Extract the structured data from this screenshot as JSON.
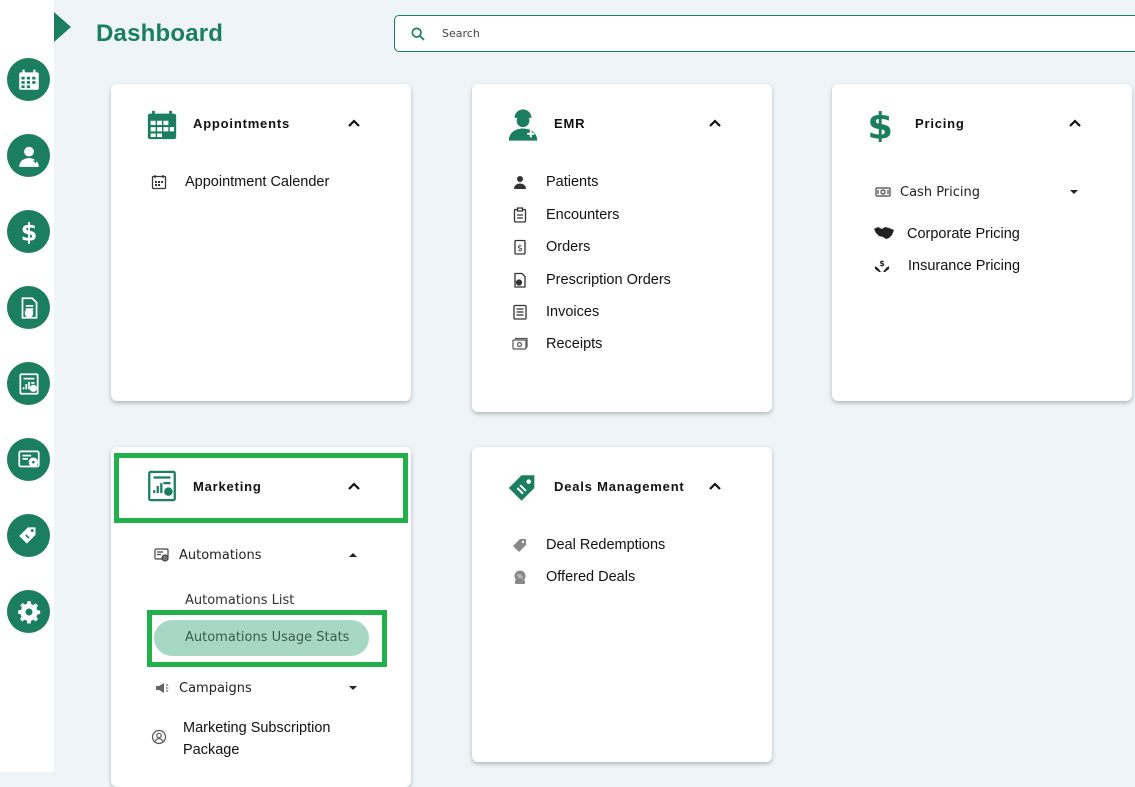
{
  "page": {
    "title": "Dashboard"
  },
  "search": {
    "placeholder": "Search"
  },
  "sidebar": {
    "items": [
      {
        "icon": "calendar-icon"
      },
      {
        "icon": "doctor-icon"
      },
      {
        "icon": "dollar-icon"
      },
      {
        "icon": "document-shield-icon"
      },
      {
        "icon": "report-chart-icon"
      },
      {
        "icon": "automation-icon"
      },
      {
        "icon": "deal-tag-icon"
      },
      {
        "icon": "gear-icon"
      }
    ]
  },
  "cards": {
    "appointments": {
      "title": "Appointments",
      "items": [
        {
          "label": "Appointment Calender",
          "icon": "calendar-small-icon"
        }
      ]
    },
    "emr": {
      "title": "EMR",
      "items": [
        {
          "label": "Patients",
          "icon": "patient-icon"
        },
        {
          "label": "Encounters",
          "icon": "clipboard-icon"
        },
        {
          "label": "Orders",
          "icon": "order-icon"
        },
        {
          "label": "Prescription Orders",
          "icon": "prescription-icon"
        },
        {
          "label": "Invoices",
          "icon": "invoice-icon"
        },
        {
          "label": "Receipts",
          "icon": "receipt-icon"
        }
      ]
    },
    "pricing": {
      "title": "Pricing",
      "cash_pricing": "Cash Pricing",
      "items": [
        {
          "label": "Corporate Pricing",
          "icon": "handshake-icon"
        },
        {
          "label": "Insurance Pricing",
          "icon": "insurance-hand-icon"
        }
      ]
    },
    "marketing": {
      "title": "Marketing",
      "automations": "Automations",
      "automations_list": "Automations List",
      "automations_usage_stats": "Automations Usage Stats",
      "campaigns": "Campaigns",
      "subscription_line1": "Marketing Subscription",
      "subscription_line2": "Package"
    },
    "deals": {
      "title": "Deals Management",
      "items": [
        {
          "label": "Deal Redemptions",
          "icon": "deal-redemption-icon"
        },
        {
          "label": "Offered Deals",
          "icon": "offered-deals-icon"
        }
      ]
    }
  },
  "colors": {
    "brand": "#1b7f5f",
    "highlight": "#22b04a",
    "selected_bg": "#a7d8c6"
  }
}
